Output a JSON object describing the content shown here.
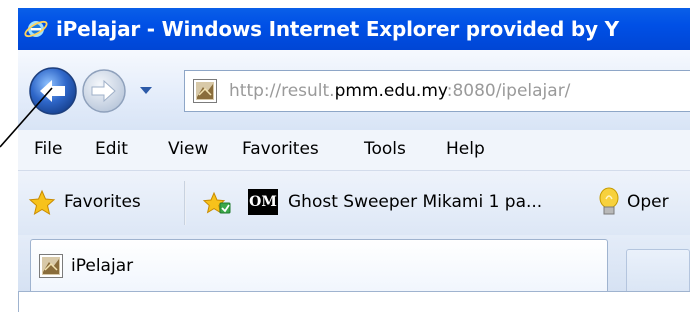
{
  "window": {
    "title": "iPelajar - Windows Internet Explorer provided by Y"
  },
  "navigation": {
    "address": {
      "prefix": "http://result.",
      "domain": "pmm.edu.my",
      "suffix": ":8080/ipelajar/"
    }
  },
  "menu": {
    "items": [
      "File",
      "Edit",
      "View",
      "Favorites",
      "Tools",
      "Help"
    ]
  },
  "favorites_bar": {
    "favorites_label": "Favorites",
    "om_icon_text": "OM",
    "link_1": "Ghost Sweeper Mikami 1 pa...",
    "link_2": "Oper"
  },
  "tabs": [
    {
      "label": "iPelajar"
    }
  ],
  "colors": {
    "title_bar": "#0050e6",
    "back_button": "#2f67c9"
  },
  "icons": {
    "window": "ie-logo-icon",
    "back": "back-arrow-icon",
    "forward": "forward-arrow-icon",
    "recent_pages": "chevron-down-icon",
    "page": "page-favicon-icon",
    "favorites": "favorites-star-icon",
    "add_favorite": "add-favorite-icon",
    "suggested_sites": "lightbulb-icon"
  }
}
